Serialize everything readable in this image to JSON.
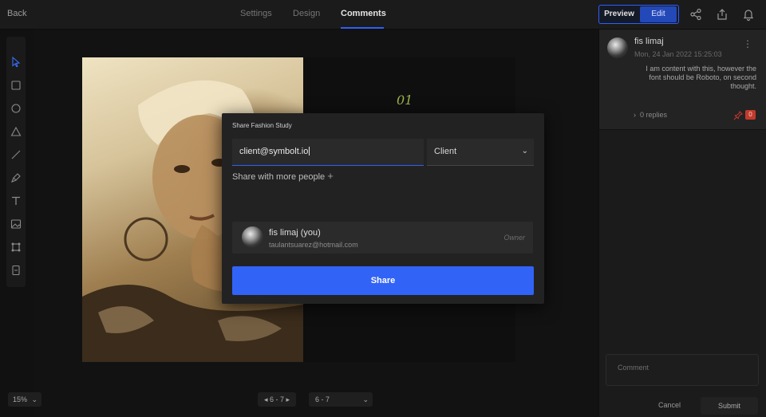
{
  "topbar": {
    "back_label": "Back",
    "tabs": [
      {
        "label": "Settings"
      },
      {
        "label": "Design"
      },
      {
        "label": "Comments"
      }
    ],
    "active_tab": "Comments",
    "mode": {
      "preview_label": "Preview",
      "edit_label": "Edit"
    },
    "icons": [
      "share-nodes-icon",
      "export-icon",
      "bell-icon"
    ]
  },
  "tools": [
    "pointer-icon",
    "rectangle-icon",
    "circle-icon",
    "triangle-icon",
    "line-icon",
    "pen-icon",
    "text-icon",
    "image-icon",
    "component-icon",
    "page-icon"
  ],
  "canvas": {
    "page_number": "01",
    "zoom": "15%",
    "pager": "6 - 7",
    "page_select": "6 - 7"
  },
  "comments": {
    "author": "fis limaj",
    "date": "Mon, 24 Jan 2022 15:25:03",
    "text": "I am content with this, however the font should be Roboto, on second thought.",
    "replies": "0 replies",
    "count": "0",
    "input_placeholder": "Comment",
    "cancel_label": "Cancel",
    "submit_label": "Submit"
  },
  "modal": {
    "title": "Share Fashion Study",
    "email_value": "client@symbolt.io",
    "role_value": "Client",
    "more_label": "Share with more people",
    "user": {
      "name": "fis limaj (you)",
      "email": "taulantsuarez@hotmail.com",
      "role": "Owner"
    },
    "share_label": "Share"
  },
  "colors": {
    "accent": "#3163f7",
    "badge": "#c23a2c",
    "page_number": "#9db24a"
  }
}
